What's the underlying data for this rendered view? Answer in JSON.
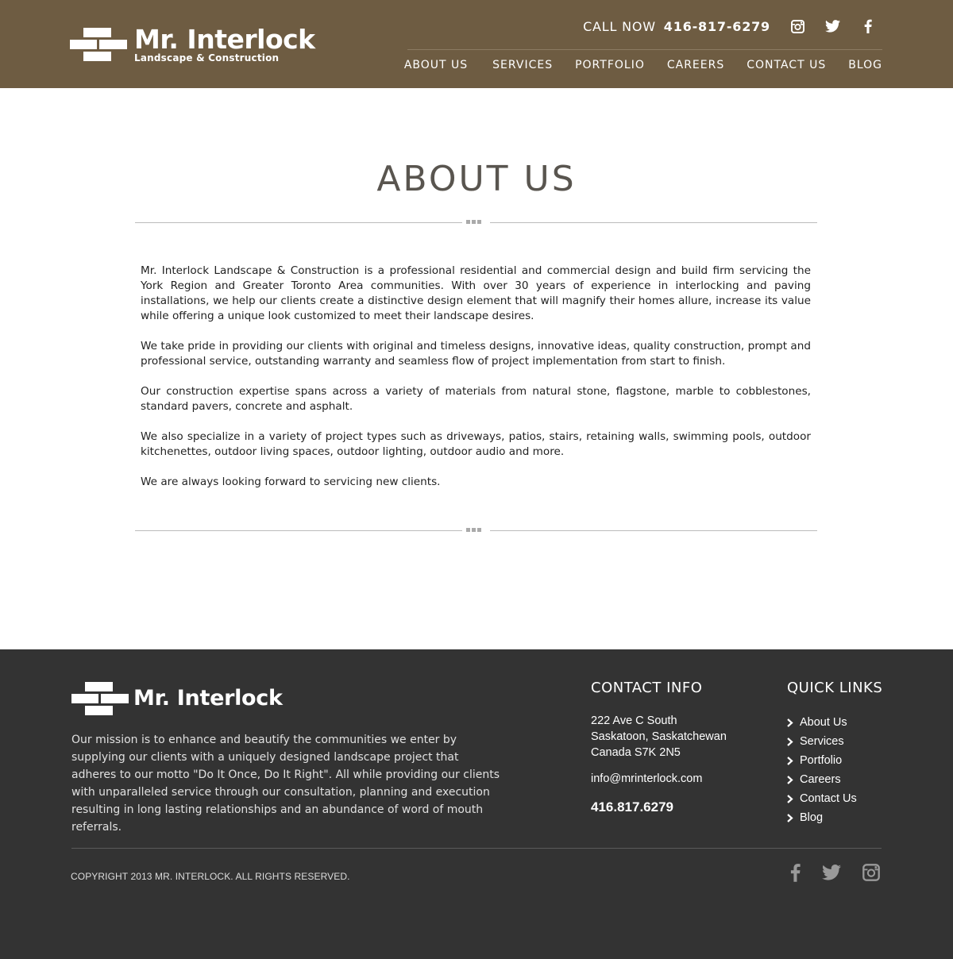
{
  "header": {
    "logo": {
      "name": "Mr. Interlock",
      "subtitle": "Landscape & Construction"
    },
    "call_now": {
      "label": "CALL NOW",
      "number": "416-817-6279"
    },
    "social_icons": [
      "instagram-icon",
      "twitter-icon",
      "facebook-icon"
    ],
    "nav": [
      {
        "label": "ABOUT US"
      },
      {
        "label": "SERVICES"
      },
      {
        "label": "PORTFOLIO"
      },
      {
        "label": "CAREERS"
      },
      {
        "label": "CONTACT US"
      },
      {
        "label": "BLOG"
      }
    ],
    "background_color": "#6e5c42"
  },
  "main": {
    "title": "ABOUT US",
    "paragraphs": [
      "Mr. Interlock Landscape & Construction is a professional residential and commercial design and build firm servicing the York Region and Greater Toronto Area communities. With over 30 years of experience in interlocking and paving installations, we help our clients create a distinctive design element that will magnify their homes allure, increase its value while offering a unique look customized to meet their landscape desires.",
      "We take pride in providing our clients with original and timeless designs, innovative ideas, quality construction, prompt and professional service, outstanding warranty and seamless flow of project implementation from start to finish.",
      "Our construction expertise spans across a variety of materials from natural stone, flagstone, marble to cobblestones, standard pavers, concrete and asphalt.",
      "We also specialize in a variety of project types such as driveways, patios, stairs, retaining walls, swimming pools, outdoor kitchenettes, outdoor living spaces, outdoor lighting, outdoor audio and more.",
      "We are always looking forward to servicing new clients."
    ]
  },
  "footer": {
    "logo_name": "Mr. Interlock",
    "mission": "Our mission is to enhance and beautify the communities we enter by supplying our clients with a uniquely designed landscape project that adheres to our motto \"Do It Once, Do It Right\". All while providing our clients with unparalleled service through our consultation, planning and execution resulting in long lasting relationships and an abundance of word of mouth referrals.",
    "contact": {
      "title": "CONTACT INFO",
      "address_line1": "222 Ave C South",
      "address_line2": "Saskatoon, Saskatchewan",
      "address_line3": "Canada S7K 2N5",
      "email": "info@mrinterlock.com",
      "phone": "416.817.6279"
    },
    "quick_links": {
      "title": "QUICK LINKS",
      "items": [
        {
          "label": "About Us"
        },
        {
          "label": "Services"
        },
        {
          "label": "Portfolio"
        },
        {
          "label": "Careers"
        },
        {
          "label": "Contact Us"
        },
        {
          "label": "Blog"
        }
      ]
    },
    "copyright": "COPYRIGHT 2013 MR. INTERLOCK. ALL RIGHTS RESERVED.",
    "social_icons": [
      "facebook-icon",
      "twitter-icon",
      "instagram-icon"
    ],
    "background_color": "#333333"
  }
}
